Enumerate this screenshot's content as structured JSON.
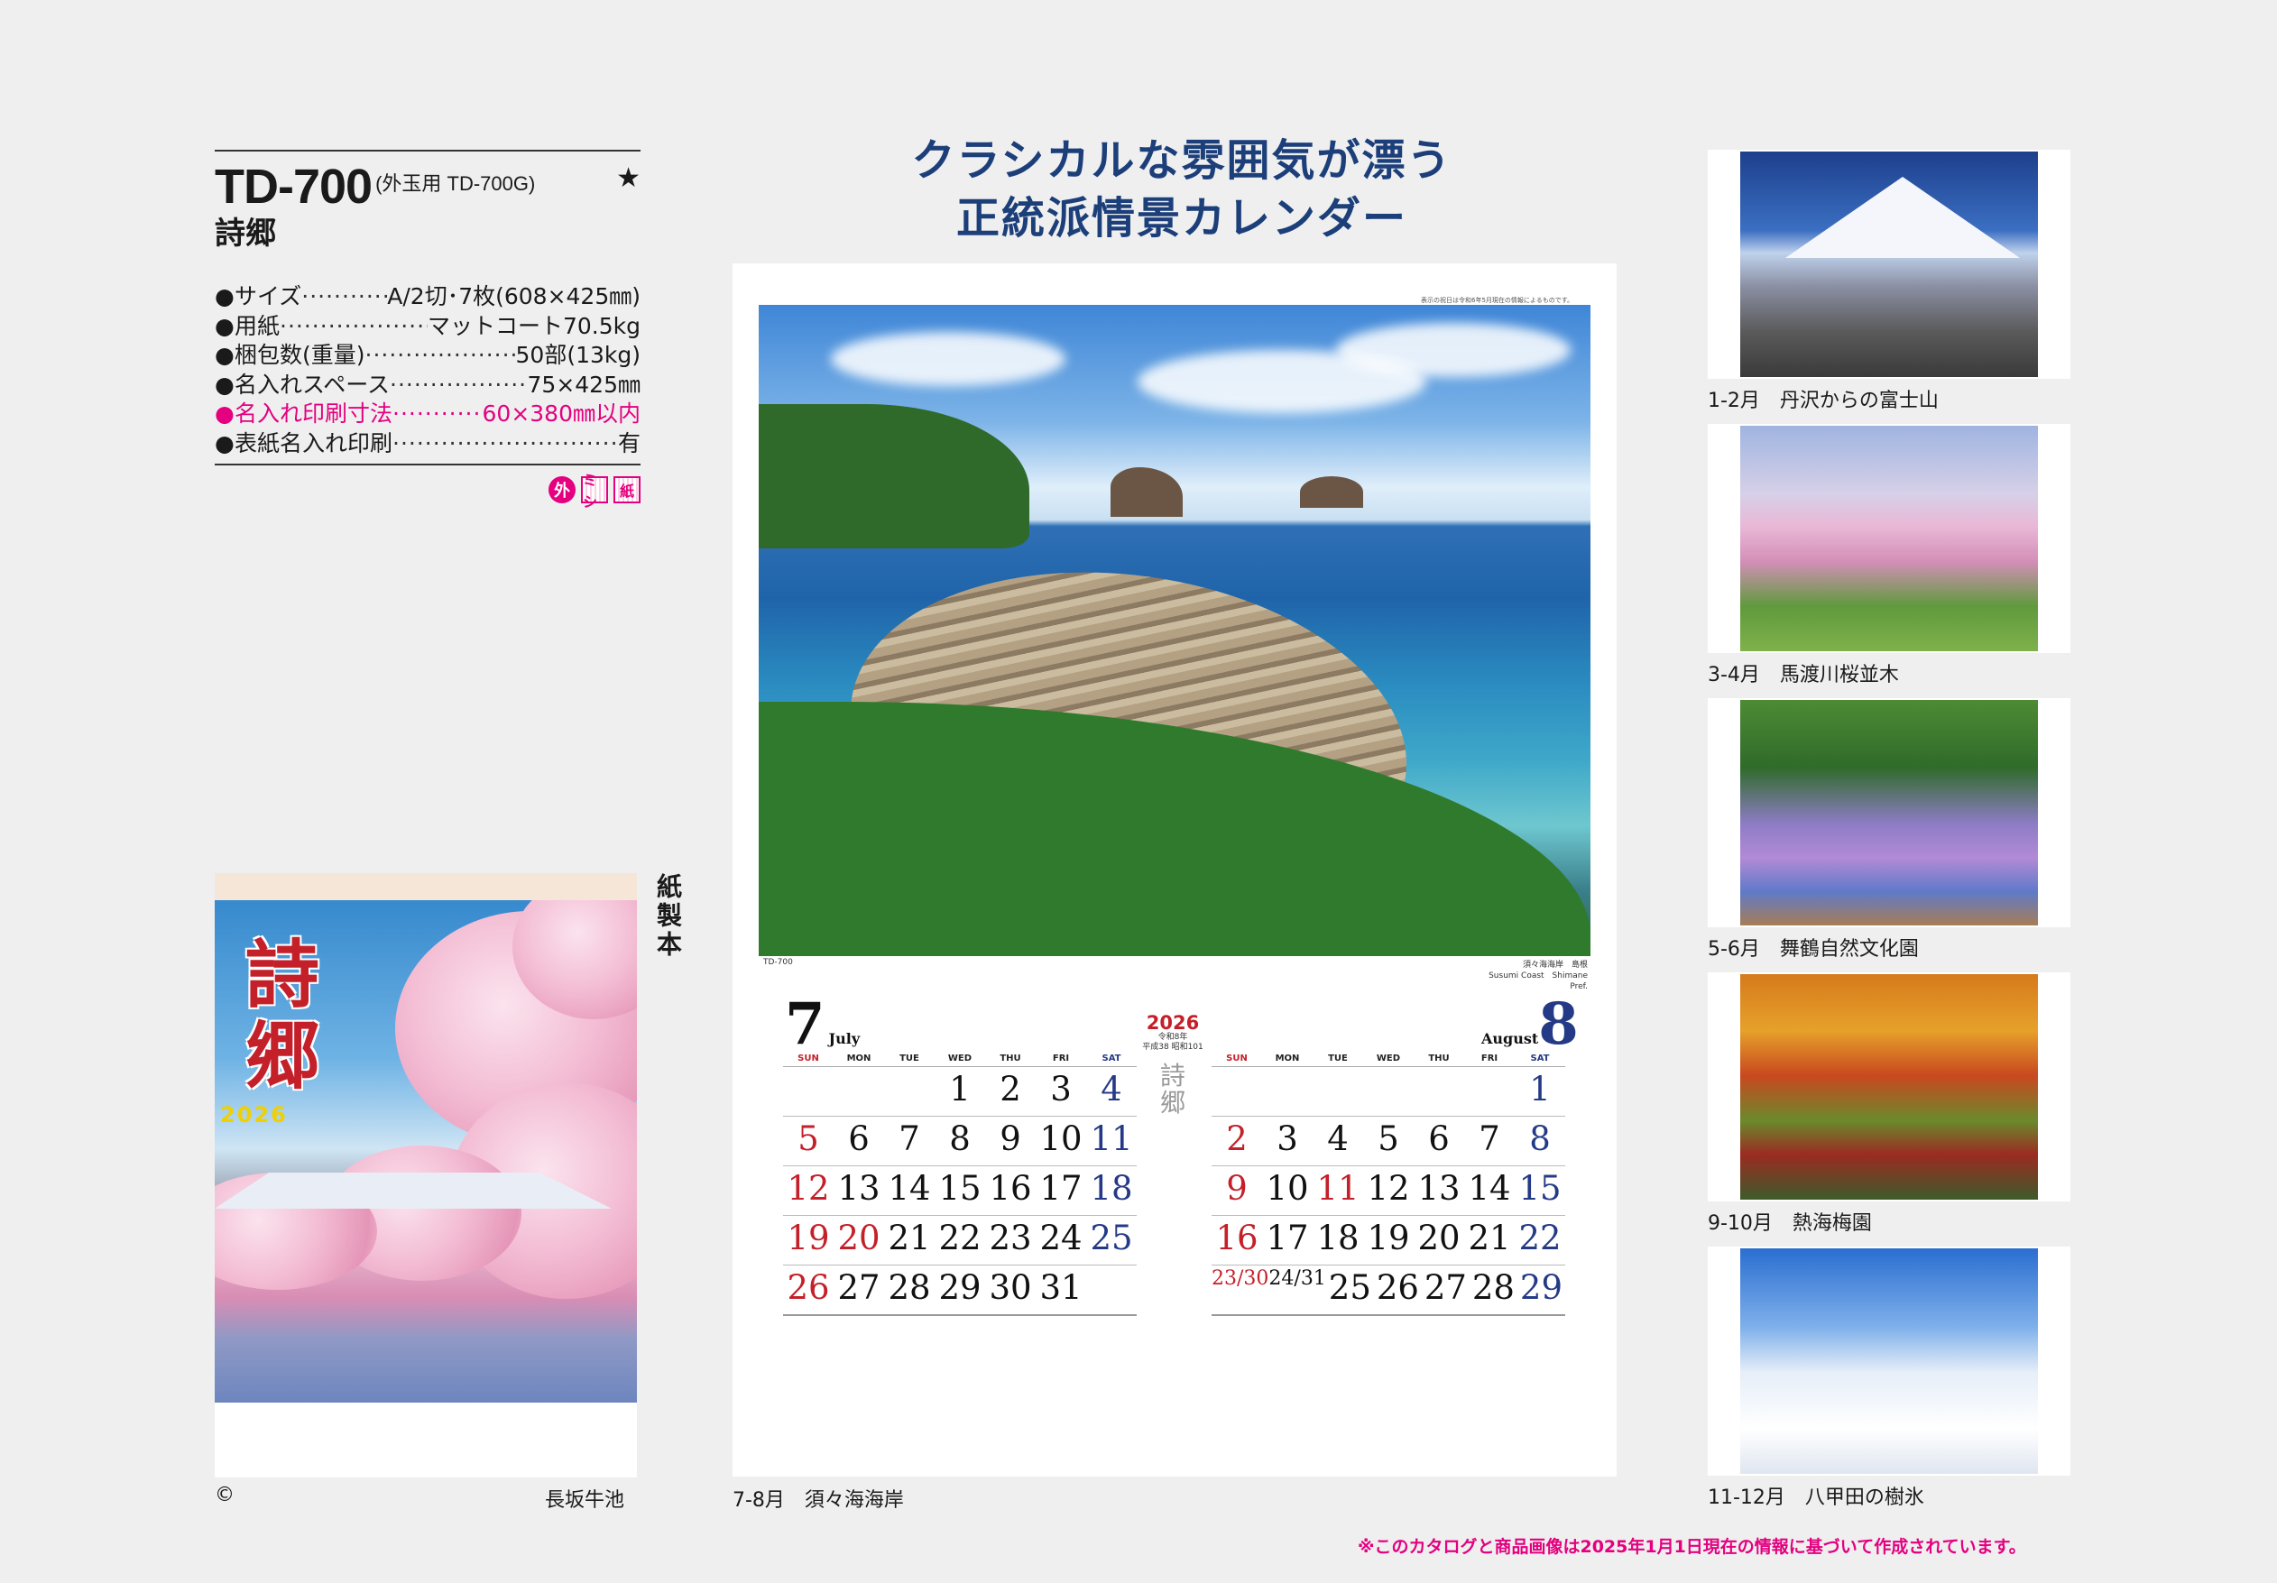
{
  "product": {
    "model": "TD-700",
    "model_sub": "(外玉用 TD-700G)",
    "star": "★",
    "name": "詩郷",
    "specs": [
      {
        "label": "サイズ",
        "value": "A/2切･7枚(608×425㎜)"
      },
      {
        "label": "用紙",
        "value": "マットコート70.5kg"
      },
      {
        "label": "梱包数(重量)",
        "value": "50部(13kg)"
      },
      {
        "label": "名入れスペース",
        "value": "75×425㎜"
      },
      {
        "label": "名入れ印刷寸法",
        "value": "60×380㎜以内",
        "highlight": true
      },
      {
        "label": "表紙名入れ印刷",
        "value": "有"
      }
    ],
    "bullet": "●",
    "badges": [
      "外",
      "ミシ",
      "紙"
    ]
  },
  "cover": {
    "title": "詩郷",
    "year": "2026",
    "side_label": "紙製本",
    "copyright": "©",
    "location": "長坂牛池"
  },
  "headline": {
    "line1": "クラシカルな雰囲気が漂う",
    "line2": "正統派情景カレンダー"
  },
  "calendar": {
    "top_note": "表示の祝日は令和6年5月現在の情報によるものです。",
    "model_small": "TD-700",
    "photo_caption_1": "須々海海岸　島根",
    "photo_caption_2": "Susumi Coast　Shimane Pref.",
    "year": "2026",
    "reiwa": "令和8年",
    "heisei": "平成38 昭和101",
    "brand": "詩郷",
    "weekdays": [
      "SUN",
      "MON",
      "TUE",
      "WED",
      "THU",
      "FRI",
      "SAT"
    ],
    "month1": {
      "number": "7",
      "name": "July",
      "weeks": [
        [
          "",
          "",
          "",
          "1",
          "2",
          "3",
          "4"
        ],
        [
          "5",
          "6",
          "7",
          "8",
          "9",
          "10",
          "11"
        ],
        [
          "12",
          "13",
          "14",
          "15",
          "16",
          "17",
          "18"
        ],
        [
          "19",
          "20",
          "21",
          "22",
          "23",
          "24",
          "25"
        ],
        [
          "26",
          "27",
          "28",
          "29",
          "30",
          "31",
          ""
        ]
      ],
      "holidays": [
        "20"
      ]
    },
    "month2": {
      "number": "8",
      "name": "August",
      "weeks": [
        [
          "",
          "",
          "",
          "",
          "",
          "",
          "1"
        ],
        [
          "2",
          "3",
          "4",
          "5",
          "6",
          "7",
          "8"
        ],
        [
          "9",
          "10",
          "11",
          "12",
          "13",
          "14",
          "15"
        ],
        [
          "16",
          "17",
          "18",
          "19",
          "20",
          "21",
          "22"
        ],
        [
          "23/30",
          "24/31",
          "25",
          "26",
          "27",
          "28",
          "29"
        ]
      ],
      "holidays": [
        "11"
      ]
    },
    "caption": "7-8月　須々海海岸"
  },
  "thumbnails": [
    {
      "caption": "1-2月　丹沢からの富士山"
    },
    {
      "caption": "3-4月　馬渡川桜並木"
    },
    {
      "caption": "5-6月　舞鶴自然文化園"
    },
    {
      "caption": "9-10月　熱海梅園"
    },
    {
      "caption": "11-12月　八甲田の樹氷"
    }
  ],
  "footnote": "※このカタログと商品画像は2025年1月1日現在の情報に基づいて作成されています。",
  "colors": {
    "accent_pink": "#e4007f",
    "headline_navy": "#1c3f7a",
    "sunday_red": "#c4202a",
    "saturday_blue": "#243a86"
  }
}
